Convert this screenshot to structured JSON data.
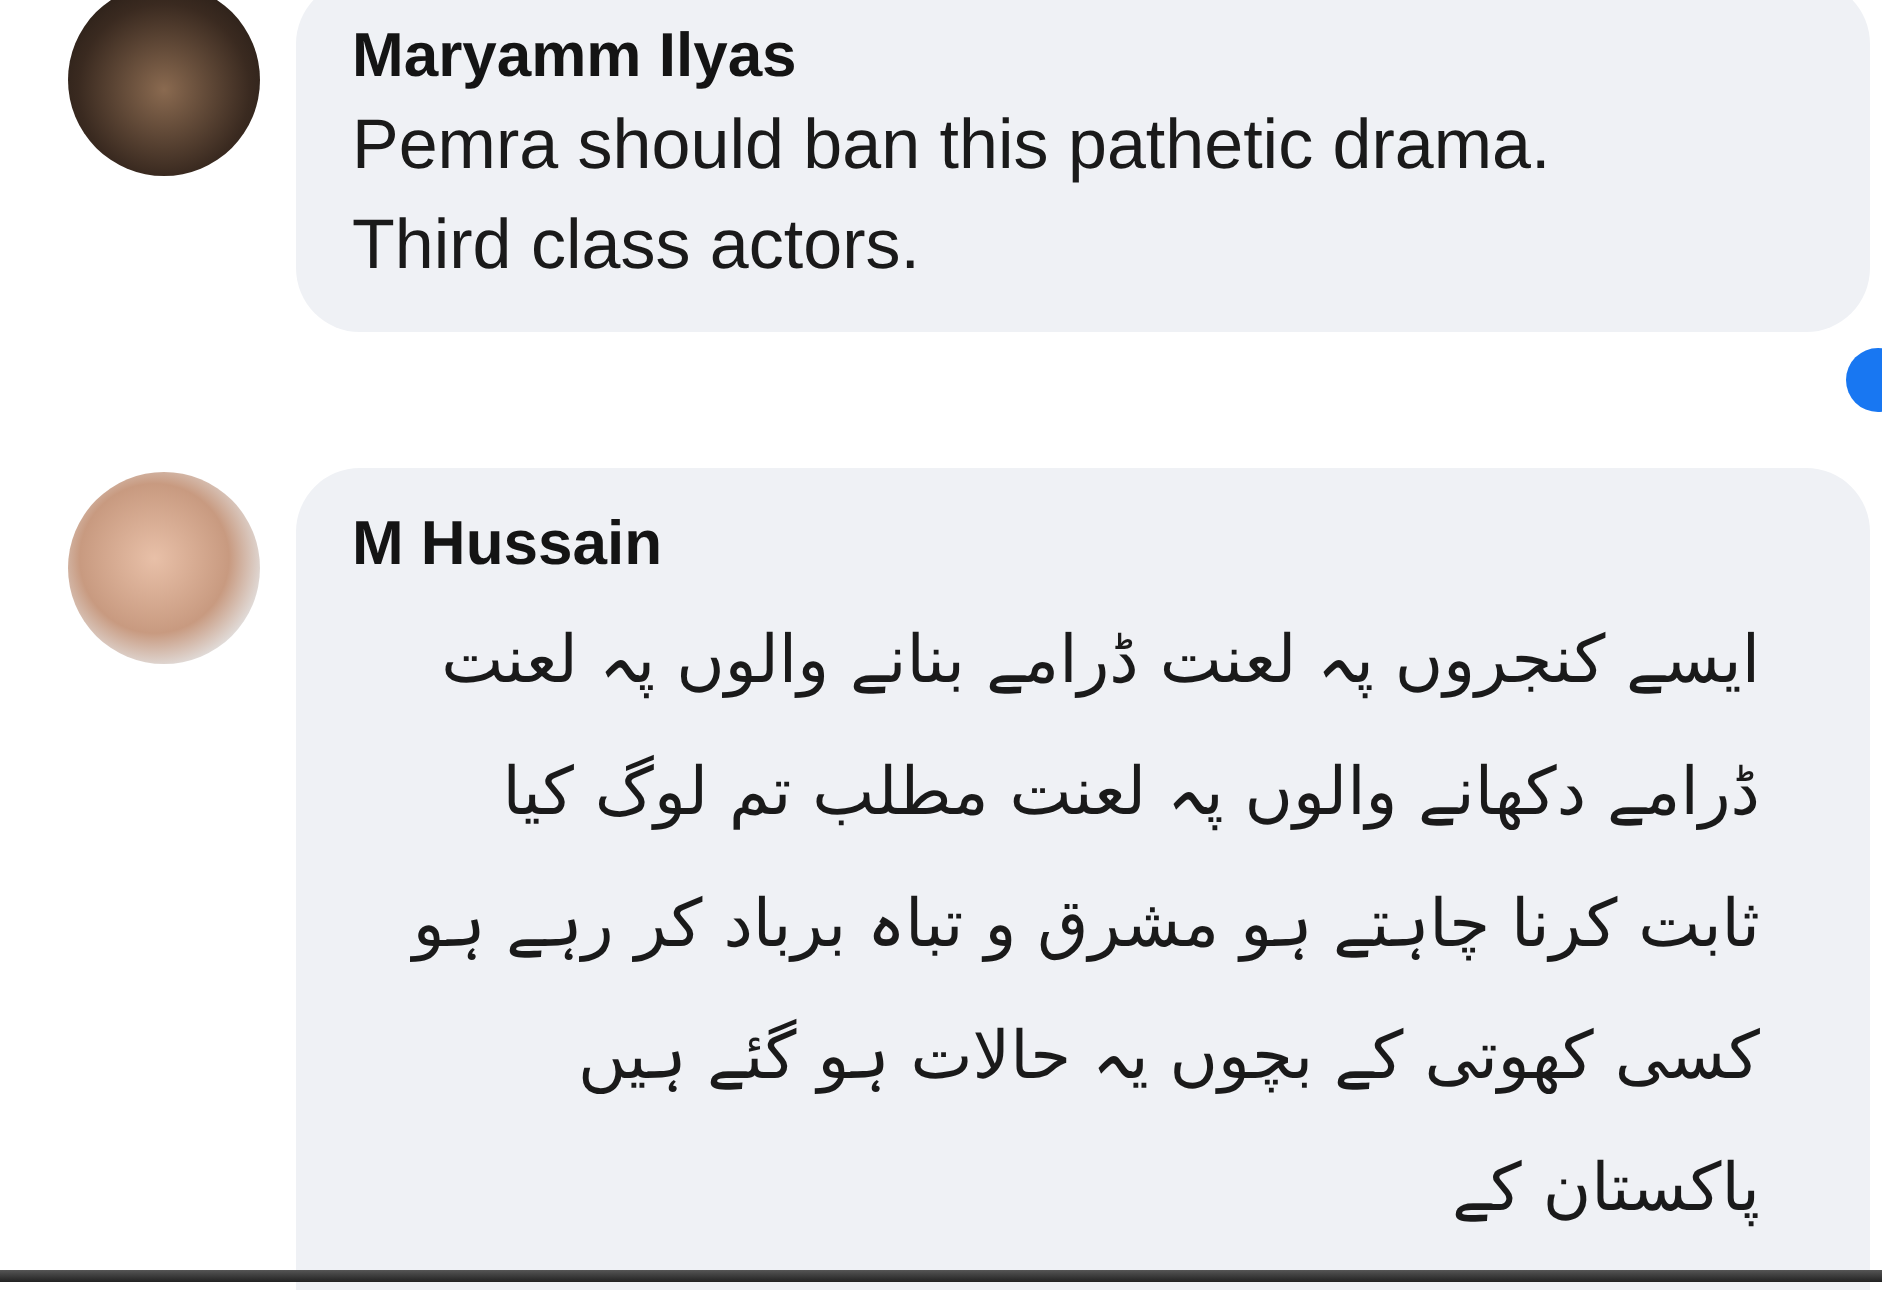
{
  "comments": [
    {
      "author": "Maryamm Ilyas",
      "lines": [
        "Pemra should ban this pathetic drama.",
        "Third class actors."
      ],
      "kind": "latin"
    },
    {
      "author": "M Hussain",
      "lines": [
        "ایسے کنجروں پہ لعنت ڈرامے بنانے والوں پہ لعنت",
        "ڈرامے دکھانے والوں پہ لعنت مطلب تم لوگ کیا",
        "ثابت کرنا چاہتے ہو مشرق و تباہ برباد کر رہے ہو",
        "کسی کھوتی کے بچوں یہ حالات ہو گئے ہیں",
        "پاکستان کے"
      ],
      "kind": "urdu"
    }
  ]
}
